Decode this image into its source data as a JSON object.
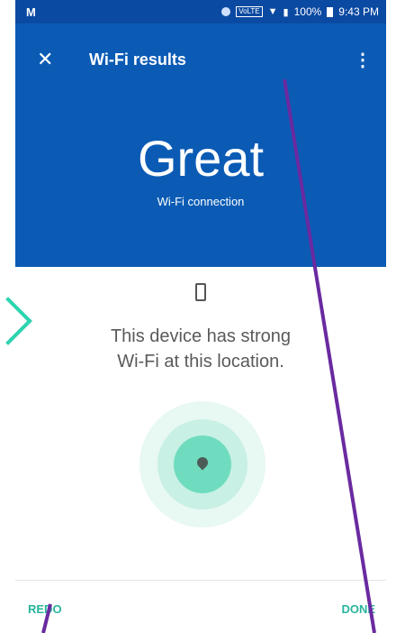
{
  "status_bar": {
    "carrier_logo": "M",
    "volte": "VoLTE",
    "battery": "100%",
    "time": "9:43 PM"
  },
  "app_bar": {
    "title": "Wi-Fi results",
    "close_icon": "close-icon",
    "menu_icon": "more-vert-icon"
  },
  "hero": {
    "rating": "Great",
    "subtitle": "Wi-Fi connection"
  },
  "result": {
    "message_line1": "This device has strong",
    "message_line2": "Wi-Fi at this location."
  },
  "actions": {
    "redo": "REDO",
    "done": "DONE"
  },
  "colors": {
    "app_bar": "#0b5bb5",
    "accent": "#27b59b",
    "annotation_line": "#6a2aa0",
    "annotation_arrow": "#2dd4b0"
  }
}
